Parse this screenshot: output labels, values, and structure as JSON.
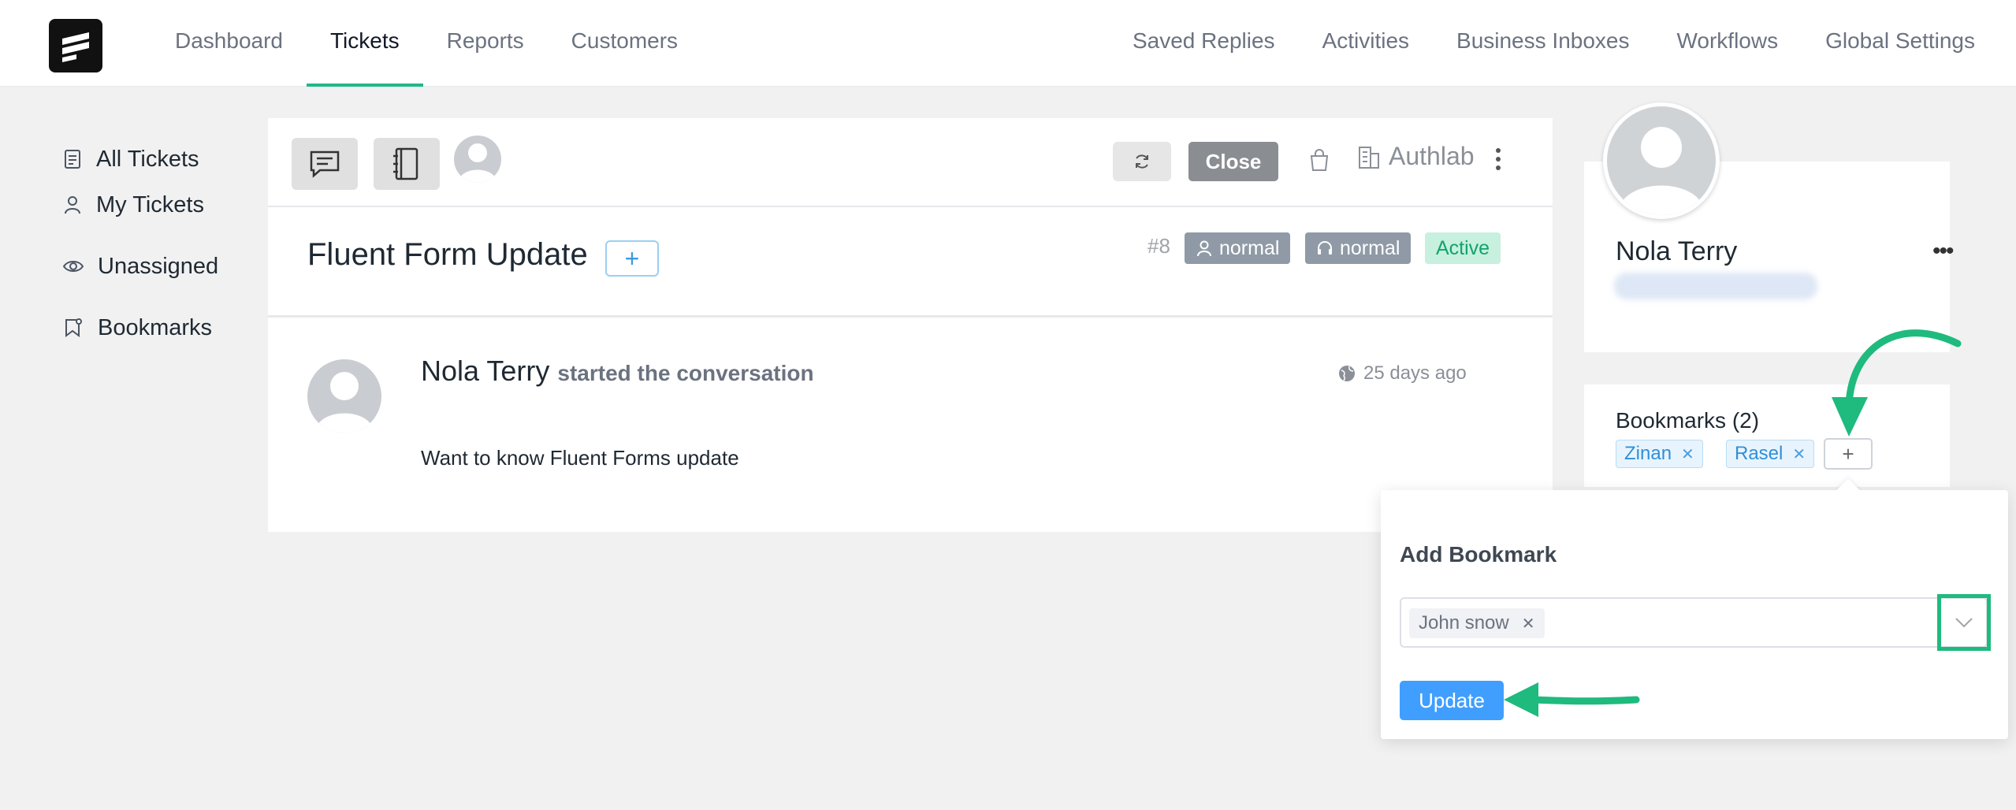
{
  "nav": {
    "left": [
      "Dashboard",
      "Tickets",
      "Reports",
      "Customers"
    ],
    "active": "Tickets",
    "right": [
      "Saved Replies",
      "Activities",
      "Business Inboxes",
      "Workflows",
      "Global Settings"
    ]
  },
  "sidebar": {
    "items": [
      {
        "label": "All Tickets",
        "icon": "document-icon"
      },
      {
        "label": "My Tickets",
        "icon": "user-icon"
      },
      {
        "label": "Unassigned",
        "icon": "eye-icon"
      },
      {
        "label": "Bookmarks",
        "icon": "bookmark-icon"
      }
    ]
  },
  "toolbar": {
    "close_label": "Close",
    "company": "Authlab"
  },
  "ticket": {
    "title": "Fluent Form Update",
    "plus": "+",
    "number": "#8",
    "priority_customer": "normal",
    "priority_agent": "normal",
    "status": "Active"
  },
  "conversation": {
    "author": "Nola Terry",
    "action": "started the conversation",
    "time": "25 days ago",
    "message": "Want to know Fluent Forms update"
  },
  "customer": {
    "name": "Nola Terry",
    "menu": "•••"
  },
  "bookmarks": {
    "title": "Bookmarks (2)",
    "tags": [
      "Zinan",
      "Rasel"
    ],
    "add": "+"
  },
  "popover": {
    "title": "Add Bookmark",
    "selected": "John snow",
    "update_label": "Update"
  },
  "colors": {
    "accent": "#1fb889",
    "primary_button": "#409eff",
    "annotation": "#1fba7e",
    "status_active_bg": "#c7f0de",
    "status_active_text": "#12a36e"
  }
}
